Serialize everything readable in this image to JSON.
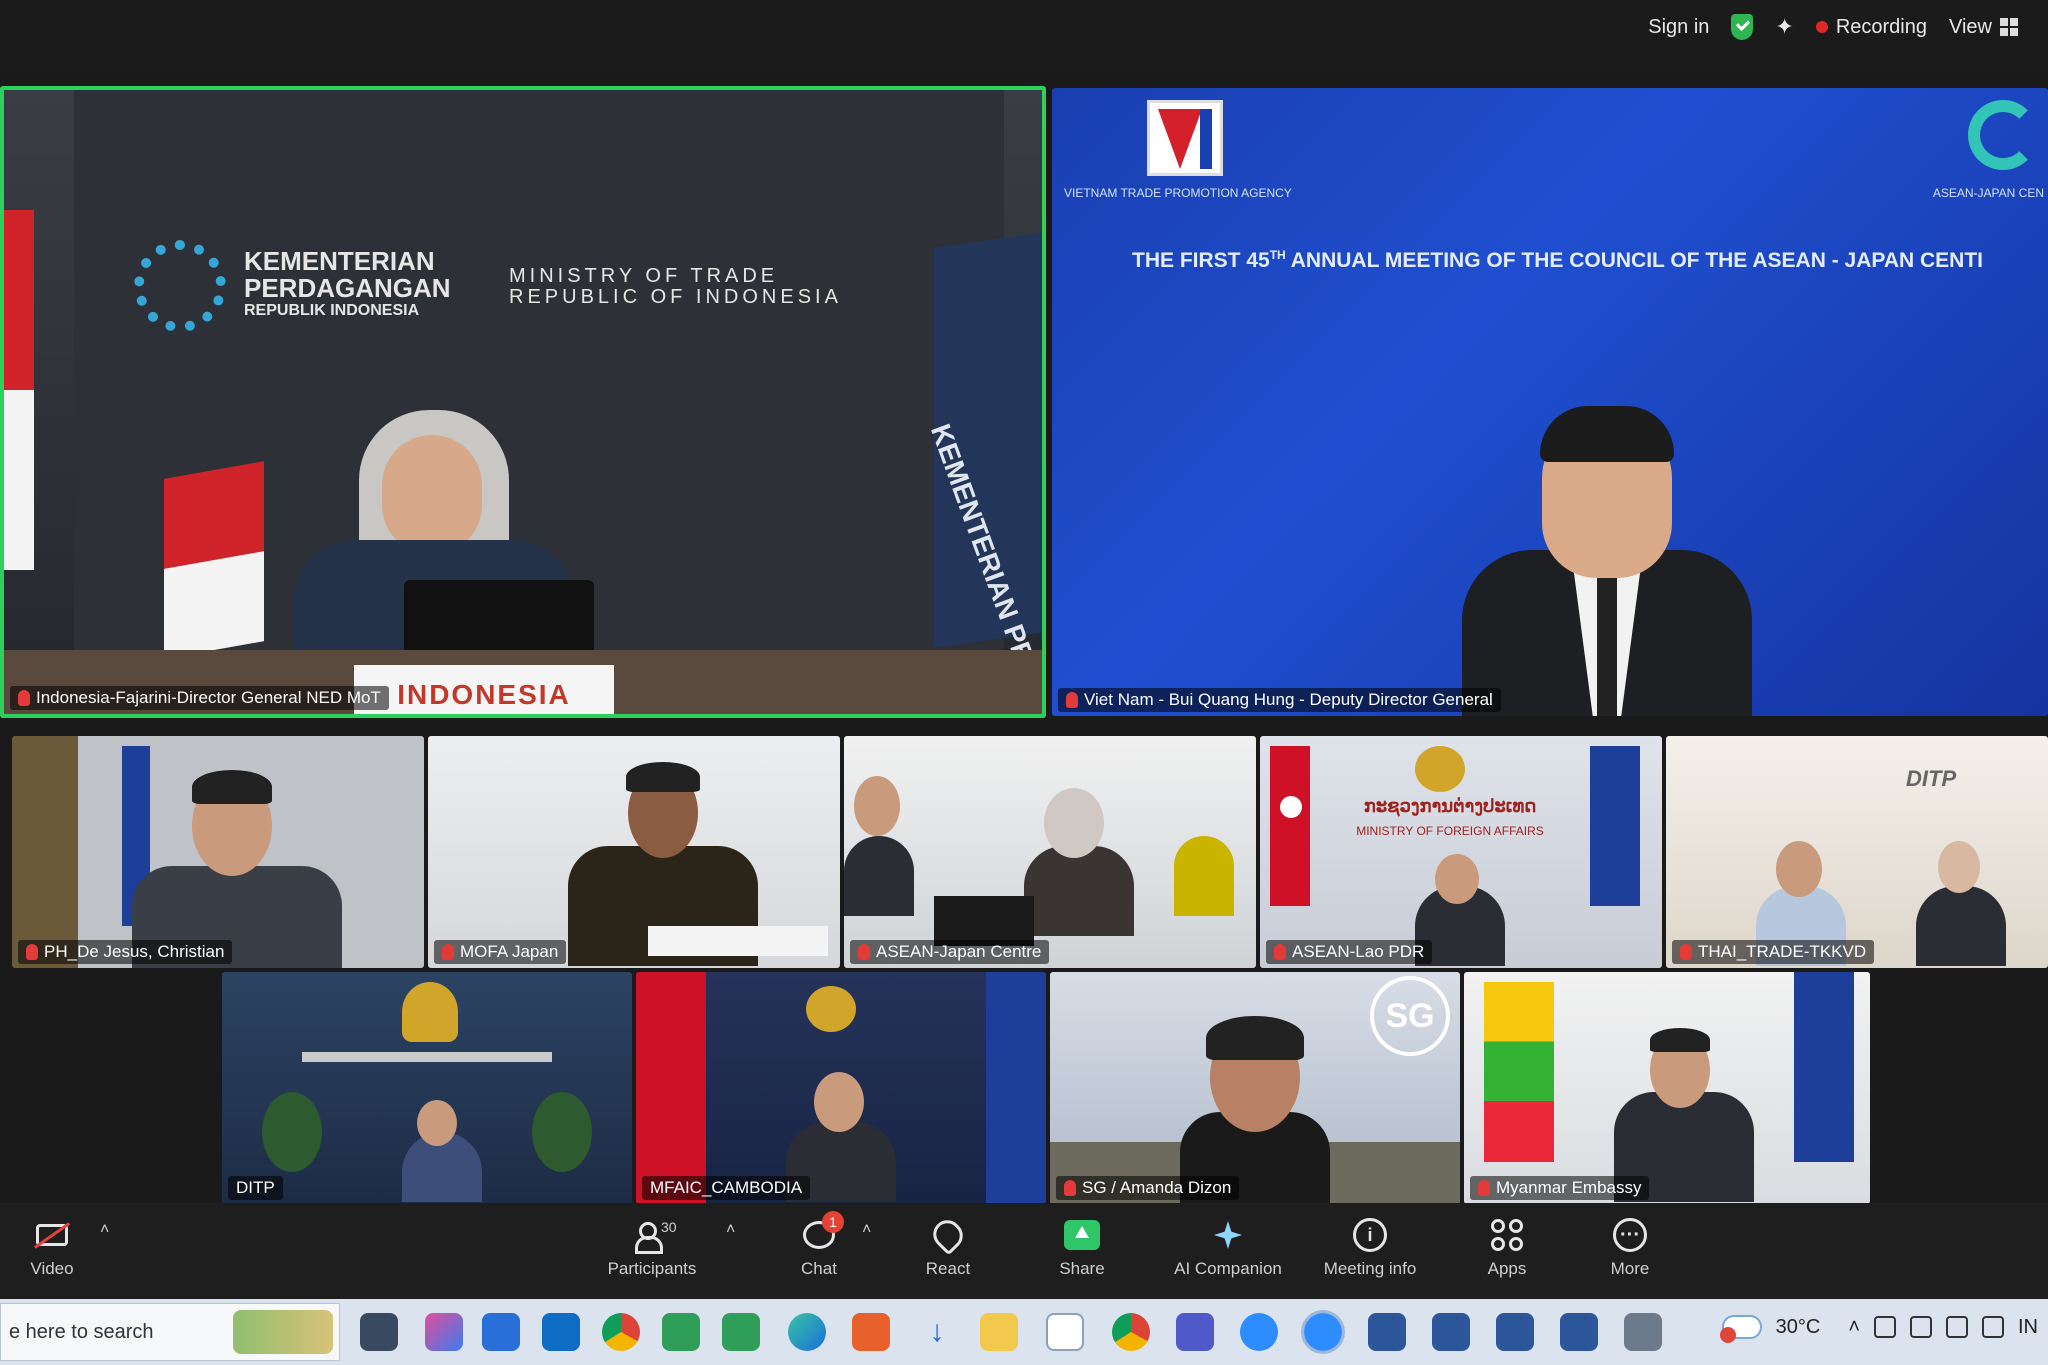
{
  "topbar": {
    "signin": "Sign in",
    "recording": "Recording",
    "view": "View"
  },
  "tiles": {
    "indonesia": {
      "name": "Indonesia-Fajarini-Director General NED MoT",
      "backdrop_lines": [
        "KEMENTERIAN",
        "PERDAGANGAN",
        "REPUBLIK INDONESIA"
      ],
      "backdrop_lines_en": [
        "MINISTRY OF TRADE",
        "REPUBLIC OF INDONESIA"
      ],
      "placard": "INDONESIA",
      "banner": "KEMENTERIAN PERDAGANGAN REPUBLIK"
    },
    "vietnam": {
      "name": "Viet Nam - Bui Quang Hung - Deputy Director General",
      "agency": "VIETNAM TRADE PROMOTION AGENCY",
      "ajc": "ASEAN-JAPAN CEN",
      "title_pre": "THE FIRST 45",
      "title_sup": "TH",
      "title_post": " ANNUAL MEETING OF THE COUNCIL OF THE ASEAN - JAPAN CENTI"
    },
    "row1": [
      {
        "name": "PH_De Jesus, Christian"
      },
      {
        "name": "MOFA Japan"
      },
      {
        "name": "ASEAN-Japan Centre"
      },
      {
        "name": "ASEAN-Lao PDR",
        "sign": "ກະຊວງການຕ່າງປະເທດ",
        "sign_en": "MINISTRY OF FOREIGN AFFAIRS"
      },
      {
        "name": "THAI_TRADE-TKKVD",
        "logo": "DITP"
      }
    ],
    "row2": [
      {
        "name": "DITP"
      },
      {
        "name": "MFAIC_CAMBODIA"
      },
      {
        "name": "SG / Amanda Dizon",
        "logo": "SG"
      },
      {
        "name": "Myanmar Embassy"
      }
    ]
  },
  "toolbar": {
    "video": "Video",
    "participants": "Participants",
    "participants_count": "30",
    "chat": "Chat",
    "chat_badge": "1",
    "react": "React",
    "share": "Share",
    "ai_companion": "AI Companion",
    "meeting_info": "Meeting info",
    "apps": "Apps",
    "more": "More"
  },
  "taskbar": {
    "search_placeholder": "e here to search",
    "temperature": "30°C",
    "lang": "IN"
  }
}
